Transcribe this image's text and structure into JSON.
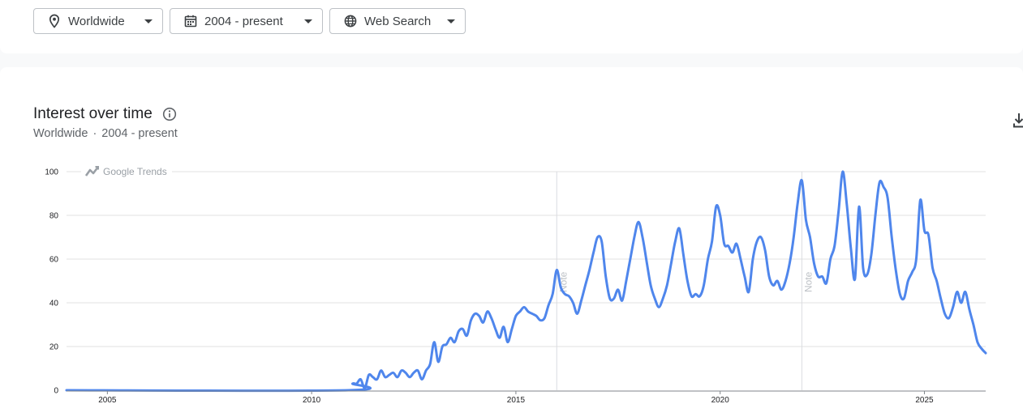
{
  "filters": {
    "location": "Worldwide",
    "time_range": "2004 - present",
    "property": "Web Search"
  },
  "icons": {
    "location": "location-pin-icon",
    "time": "calendar-icon",
    "property": "globe-icon",
    "info": "info-icon",
    "download": "download-icon",
    "watermark": "trends-logo-icon"
  },
  "card": {
    "title": "Interest over time",
    "subtitle_location": "Worldwide",
    "subtitle_separator": "·",
    "subtitle_time": "2004 - present"
  },
  "colors": {
    "series": "#4f86ec",
    "grid": "#e0e0e0"
  },
  "chart_data": {
    "type": "line",
    "watermark": "Google Trends",
    "xlim": [
      2004.0,
      2026.5
    ],
    "ylim": [
      0,
      100
    ],
    "xticks": [
      2005,
      2010,
      2015,
      2020,
      2025
    ],
    "yticks": [
      0,
      20,
      40,
      60,
      80,
      100
    ],
    "grid": true,
    "notes": [
      {
        "x": 2016.0,
        "label": "Note"
      },
      {
        "x": 2022.0,
        "label": "Note"
      }
    ],
    "series": [
      {
        "values": [
          [
            2004.0,
            0
          ],
          [
            2010.9,
            0
          ],
          [
            2011.0,
            3
          ],
          [
            2011.1,
            3
          ],
          [
            2011.2,
            5
          ],
          [
            2011.3,
            1
          ],
          [
            2011.4,
            7
          ],
          [
            2011.5,
            6
          ],
          [
            2011.6,
            5
          ],
          [
            2011.7,
            9
          ],
          [
            2011.8,
            6
          ],
          [
            2011.9,
            7
          ],
          [
            2012.0,
            8
          ],
          [
            2012.1,
            6
          ],
          [
            2012.2,
            9
          ],
          [
            2012.3,
            8
          ],
          [
            2012.4,
            6
          ],
          [
            2012.5,
            8
          ],
          [
            2012.6,
            9
          ],
          [
            2012.7,
            5
          ],
          [
            2012.8,
            9
          ],
          [
            2012.9,
            12
          ],
          [
            2013.0,
            22
          ],
          [
            2013.1,
            13
          ],
          [
            2013.2,
            20
          ],
          [
            2013.3,
            21
          ],
          [
            2013.4,
            24
          ],
          [
            2013.5,
            22
          ],
          [
            2013.6,
            27
          ],
          [
            2013.7,
            28
          ],
          [
            2013.8,
            25
          ],
          [
            2013.9,
            32
          ],
          [
            2014.0,
            35
          ],
          [
            2014.1,
            34
          ],
          [
            2014.2,
            31
          ],
          [
            2014.3,
            36
          ],
          [
            2014.4,
            33
          ],
          [
            2014.5,
            28
          ],
          [
            2014.6,
            24
          ],
          [
            2014.7,
            29
          ],
          [
            2014.8,
            22
          ],
          [
            2014.9,
            28
          ],
          [
            2015.0,
            34
          ],
          [
            2015.1,
            36
          ],
          [
            2015.2,
            38
          ],
          [
            2015.3,
            36
          ],
          [
            2015.4,
            35
          ],
          [
            2015.5,
            34
          ],
          [
            2015.6,
            32
          ],
          [
            2015.7,
            33
          ],
          [
            2015.8,
            39
          ],
          [
            2015.9,
            44
          ],
          [
            2016.0,
            55
          ],
          [
            2016.1,
            47
          ],
          [
            2016.2,
            44
          ],
          [
            2016.3,
            43
          ],
          [
            2016.4,
            40
          ],
          [
            2016.5,
            35
          ],
          [
            2016.6,
            41
          ],
          [
            2016.7,
            48
          ],
          [
            2016.8,
            55
          ],
          [
            2016.9,
            63
          ],
          [
            2017.0,
            70
          ],
          [
            2017.1,
            68
          ],
          [
            2017.2,
            52
          ],
          [
            2017.3,
            42
          ],
          [
            2017.4,
            42
          ],
          [
            2017.5,
            46
          ],
          [
            2017.6,
            41
          ],
          [
            2017.7,
            50
          ],
          [
            2017.8,
            60
          ],
          [
            2017.9,
            70
          ],
          [
            2018.0,
            77
          ],
          [
            2018.1,
            70
          ],
          [
            2018.2,
            59
          ],
          [
            2018.3,
            48
          ],
          [
            2018.4,
            42
          ],
          [
            2018.5,
            38
          ],
          [
            2018.6,
            42
          ],
          [
            2018.7,
            48
          ],
          [
            2018.8,
            58
          ],
          [
            2018.9,
            68
          ],
          [
            2019.0,
            74
          ],
          [
            2019.1,
            62
          ],
          [
            2019.2,
            50
          ],
          [
            2019.3,
            43
          ],
          [
            2019.4,
            44
          ],
          [
            2019.5,
            43
          ],
          [
            2019.6,
            48
          ],
          [
            2019.7,
            60
          ],
          [
            2019.8,
            68
          ],
          [
            2019.9,
            84
          ],
          [
            2020.0,
            80
          ],
          [
            2020.1,
            67
          ],
          [
            2020.2,
            66
          ],
          [
            2020.3,
            63
          ],
          [
            2020.4,
            67
          ],
          [
            2020.5,
            60
          ],
          [
            2020.6,
            52
          ],
          [
            2020.7,
            45
          ],
          [
            2020.8,
            60
          ],
          [
            2020.9,
            68
          ],
          [
            2021.0,
            70
          ],
          [
            2021.1,
            64
          ],
          [
            2021.2,
            52
          ],
          [
            2021.3,
            48
          ],
          [
            2021.4,
            50
          ],
          [
            2021.5,
            46
          ],
          [
            2021.6,
            50
          ],
          [
            2021.7,
            58
          ],
          [
            2021.8,
            70
          ],
          [
            2021.9,
            86
          ],
          [
            2022.0,
            96
          ],
          [
            2022.1,
            78
          ],
          [
            2022.2,
            70
          ],
          [
            2022.3,
            58
          ],
          [
            2022.4,
            52
          ],
          [
            2022.5,
            52
          ],
          [
            2022.6,
            49
          ],
          [
            2022.7,
            60
          ],
          [
            2022.8,
            66
          ],
          [
            2022.9,
            82
          ],
          [
            2023.0,
            100
          ],
          [
            2023.1,
            85
          ],
          [
            2023.2,
            65
          ],
          [
            2023.3,
            51
          ],
          [
            2023.4,
            84
          ],
          [
            2023.5,
            56
          ],
          [
            2023.6,
            53
          ],
          [
            2023.7,
            62
          ],
          [
            2023.8,
            80
          ],
          [
            2023.9,
            95
          ],
          [
            2024.0,
            93
          ],
          [
            2024.1,
            88
          ],
          [
            2024.2,
            70
          ],
          [
            2024.3,
            55
          ],
          [
            2024.4,
            44
          ],
          [
            2024.5,
            42
          ],
          [
            2024.6,
            50
          ],
          [
            2024.7,
            54
          ],
          [
            2024.8,
            60
          ],
          [
            2024.9,
            87
          ],
          [
            2025.0,
            73
          ],
          [
            2025.1,
            71
          ],
          [
            2025.2,
            56
          ],
          [
            2025.3,
            50
          ],
          [
            2025.4,
            42
          ],
          [
            2025.5,
            35
          ],
          [
            2025.6,
            33
          ],
          [
            2025.7,
            38
          ],
          [
            2025.8,
            45
          ],
          [
            2025.9,
            40
          ],
          [
            2026.0,
            45
          ],
          [
            2026.1,
            37
          ],
          [
            2026.2,
            30
          ],
          [
            2026.3,
            22
          ],
          [
            2026.4,
            19
          ],
          [
            2026.5,
            17
          ]
        ]
      }
    ]
  }
}
